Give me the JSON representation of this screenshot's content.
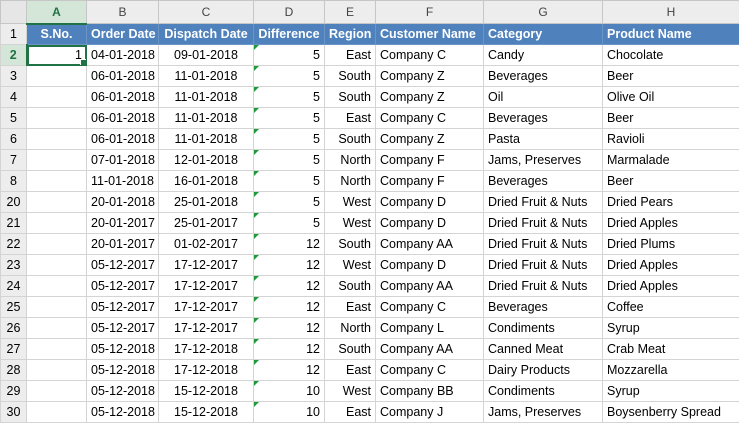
{
  "col_letters": [
    "A",
    "B",
    "C",
    "D",
    "E",
    "F",
    "G",
    "H"
  ],
  "header_row_number": "1",
  "headers": [
    "S.No.",
    "Order Date",
    "Dispatch Date",
    "Difference",
    "Region",
    "Customer Name",
    "Category",
    "Product Name"
  ],
  "rows": [
    {
      "rownum": "2",
      "sno": "1",
      "order_date": "04-01-2018",
      "dispatch_date": "09-01-2018",
      "difference": "5",
      "region": "East",
      "customer": "Company C",
      "category": "Candy",
      "product": "Chocolate"
    },
    {
      "rownum": "3",
      "sno": "",
      "order_date": "06-01-2018",
      "dispatch_date": "11-01-2018",
      "difference": "5",
      "region": "South",
      "customer": "Company Z",
      "category": "Beverages",
      "product": "Beer"
    },
    {
      "rownum": "4",
      "sno": "",
      "order_date": "06-01-2018",
      "dispatch_date": "11-01-2018",
      "difference": "5",
      "region": "South",
      "customer": "Company Z",
      "category": "Oil",
      "product": "Olive Oil"
    },
    {
      "rownum": "5",
      "sno": "",
      "order_date": "06-01-2018",
      "dispatch_date": "11-01-2018",
      "difference": "5",
      "region": "East",
      "customer": "Company C",
      "category": "Beverages",
      "product": "Beer"
    },
    {
      "rownum": "6",
      "sno": "",
      "order_date": "06-01-2018",
      "dispatch_date": "11-01-2018",
      "difference": "5",
      "region": "South",
      "customer": "Company Z",
      "category": "Pasta",
      "product": "Ravioli"
    },
    {
      "rownum": "7",
      "sno": "",
      "order_date": "07-01-2018",
      "dispatch_date": "12-01-2018",
      "difference": "5",
      "region": "North",
      "customer": "Company F",
      "category": "Jams, Preserves",
      "product": "Marmalade"
    },
    {
      "rownum": "8",
      "sno": "",
      "order_date": "11-01-2018",
      "dispatch_date": "16-01-2018",
      "difference": "5",
      "region": "North",
      "customer": "Company F",
      "category": "Beverages",
      "product": "Beer"
    },
    {
      "rownum": "20",
      "sno": "",
      "order_date": "20-01-2018",
      "dispatch_date": "25-01-2018",
      "difference": "5",
      "region": "West",
      "customer": "Company D",
      "category": "Dried Fruit & Nuts",
      "product": "Dried Pears"
    },
    {
      "rownum": "21",
      "sno": "",
      "order_date": "20-01-2017",
      "dispatch_date": "25-01-2017",
      "difference": "5",
      "region": "West",
      "customer": "Company D",
      "category": "Dried Fruit & Nuts",
      "product": "Dried Apples"
    },
    {
      "rownum": "22",
      "sno": "",
      "order_date": "20-01-2017",
      "dispatch_date": "01-02-2017",
      "difference": "12",
      "region": "South",
      "customer": "Company AA",
      "category": "Dried Fruit & Nuts",
      "product": "Dried Plums"
    },
    {
      "rownum": "23",
      "sno": "",
      "order_date": "05-12-2017",
      "dispatch_date": "17-12-2017",
      "difference": "12",
      "region": "West",
      "customer": "Company D",
      "category": "Dried Fruit & Nuts",
      "product": "Dried Apples"
    },
    {
      "rownum": "24",
      "sno": "",
      "order_date": "05-12-2017",
      "dispatch_date": "17-12-2017",
      "difference": "12",
      "region": "South",
      "customer": "Company AA",
      "category": "Dried Fruit & Nuts",
      "product": "Dried Apples"
    },
    {
      "rownum": "25",
      "sno": "",
      "order_date": "05-12-2017",
      "dispatch_date": "17-12-2017",
      "difference": "12",
      "region": "East",
      "customer": "Company C",
      "category": "Beverages",
      "product": "Coffee"
    },
    {
      "rownum": "26",
      "sno": "",
      "order_date": "05-12-2017",
      "dispatch_date": "17-12-2017",
      "difference": "12",
      "region": "North",
      "customer": "Company L",
      "category": "Condiments",
      "product": "Syrup"
    },
    {
      "rownum": "27",
      "sno": "",
      "order_date": "05-12-2018",
      "dispatch_date": "17-12-2018",
      "difference": "12",
      "region": "South",
      "customer": "Company AA",
      "category": "Canned Meat",
      "product": "Crab Meat"
    },
    {
      "rownum": "28",
      "sno": "",
      "order_date": "05-12-2018",
      "dispatch_date": "17-12-2018",
      "difference": "12",
      "region": "East",
      "customer": "Company C",
      "category": "Dairy Products",
      "product": "Mozzarella"
    },
    {
      "rownum": "29",
      "sno": "",
      "order_date": "05-12-2018",
      "dispatch_date": "15-12-2018",
      "difference": "10",
      "region": "West",
      "customer": "Company BB",
      "category": "Condiments",
      "product": "Syrup"
    },
    {
      "rownum": "30",
      "sno": "",
      "order_date": "05-12-2018",
      "dispatch_date": "15-12-2018",
      "difference": "10",
      "region": "East",
      "customer": "Company J",
      "category": "Jams, Preserves",
      "product": "Boysenberry Spread"
    }
  ],
  "colors": {
    "header_fill": "#4f81bd",
    "header_text": "#ffffff",
    "selection": "#217346",
    "error_indicator": "#1f9a3a"
  }
}
